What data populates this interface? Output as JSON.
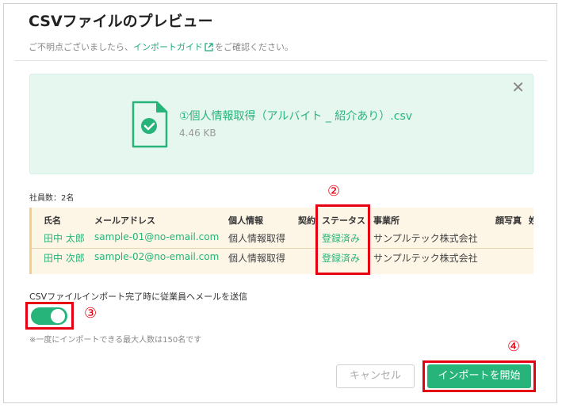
{
  "dialog": {
    "title": "CSVファイルのプレビュー",
    "help_prefix": "ご不明点ございましたら、",
    "help_link": "インポートガイド",
    "help_suffix": "をご確認ください。"
  },
  "file": {
    "name": "①個人情報取得（アルバイト _ 紹介あり）.csv",
    "size": "4.46 KB",
    "icon": "file-check-icon"
  },
  "table": {
    "count_label": "社員数：2名",
    "headers": [
      "氏名",
      "メールアドレス",
      "個人情報",
      "契約",
      "ステータス",
      "事業所",
      "顔写真",
      "姓"
    ],
    "rows": [
      {
        "name": "田中 太郎",
        "email": "sample-01@no-email.com",
        "info": "個人情報取得",
        "status": "登録済み",
        "office": "サンプルテック株式会社"
      },
      {
        "name": "田中 次郎",
        "email": "sample-02@no-email.com",
        "info": "個人情報取得",
        "status": "登録済み",
        "office": "サンプルテック株式会社"
      }
    ]
  },
  "notify": {
    "label": "CSVファイルインポート完了時に従業員へメールを送信",
    "enabled": true,
    "note": "※一度にインポートできる最大人数は150名です"
  },
  "buttons": {
    "cancel": "キャンセル",
    "start": "インポートを開始"
  },
  "markers": [
    "②",
    "③",
    "④"
  ],
  "colors": {
    "accent": "#27b47a",
    "marker": "#e60012",
    "table_bg": "#fdf5e6",
    "file_bg": "#e6f7f0"
  }
}
